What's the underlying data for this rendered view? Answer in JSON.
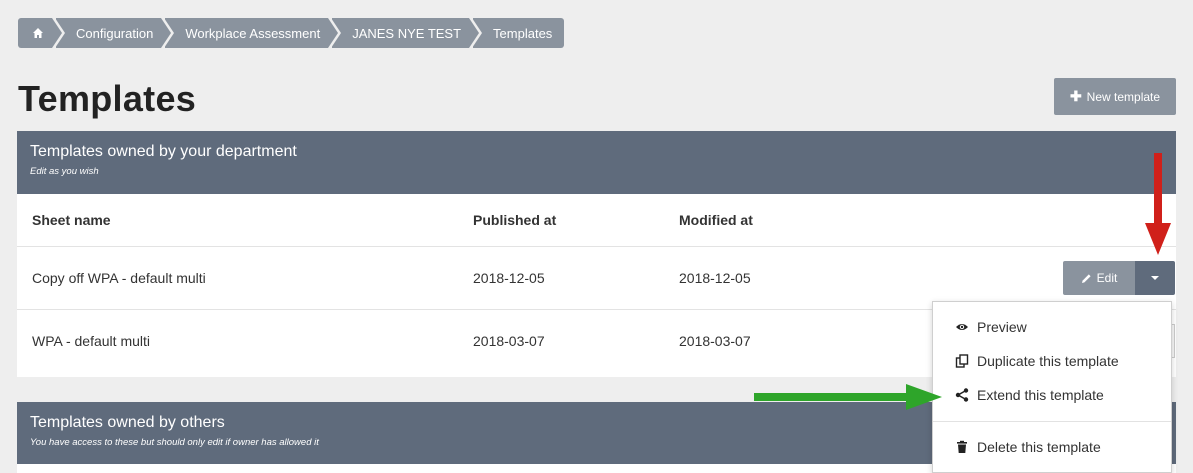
{
  "breadcrumb": {
    "home_icon": "home-icon",
    "items": [
      "Configuration",
      "Workplace Assessment",
      "JANES NYE TEST",
      "Templates"
    ]
  },
  "page": {
    "title": "Templates",
    "new_template_label": "New template"
  },
  "own_panel": {
    "title": "Templates owned by your department",
    "subtitle": "Edit as you wish",
    "columns": [
      "Sheet name",
      "Published at",
      "Modified at"
    ],
    "rows": [
      {
        "name": "Copy off WPA - default multi",
        "published": "2018-12-05",
        "modified": "2018-12-05"
      },
      {
        "name": "WPA - default multi",
        "published": "2018-03-07",
        "modified": "2018-03-07"
      }
    ],
    "edit_label": "Edit"
  },
  "others_panel": {
    "title": "Templates owned by others",
    "subtitle": "You have access to these but should only edit if owner has allowed it"
  },
  "dropdown": {
    "items": [
      {
        "label": "Preview",
        "icon": "eye-icon"
      },
      {
        "label": "Duplicate this template",
        "icon": "copy-icon"
      },
      {
        "label": "Extend this template",
        "icon": "share-icon"
      },
      {
        "label": "Delete this template",
        "icon": "trash-icon"
      }
    ]
  },
  "colors": {
    "header_bg": "#5f6b7c",
    "button_bg": "#8a939e",
    "page_bg": "#eeeeee",
    "annotation_red": "#d0201a",
    "annotation_green": "#2ea52a"
  }
}
